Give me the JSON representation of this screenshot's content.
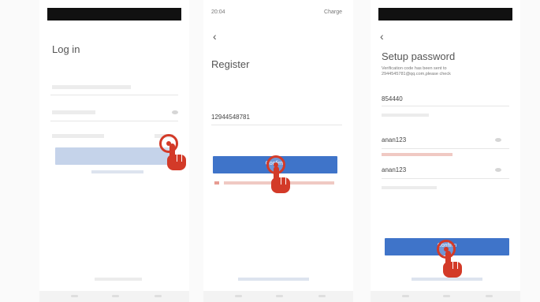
{
  "screen1": {
    "title": "Log in",
    "confirm_button_label": ""
  },
  "screen2": {
    "status_time": "20:04",
    "status_battery": "Charge",
    "back_icon": "chevron-left",
    "title": "Register",
    "phone_value": "12944548781",
    "confirm_button_label": "Confirm"
  },
  "screen3": {
    "back_icon": "chevron-left",
    "title": "Setup password",
    "verification_note": "Verification code has been sent to 2944545781@qq.com,please check",
    "code_value": "854440",
    "password_value": "anan123",
    "confirm_password_value": "anan123",
    "confirm_button_label": "Confirm"
  },
  "colors": {
    "accent_blue": "#3f74c9",
    "disabled_blue": "#c5d3ea",
    "tap_indicator": "#d33a28"
  }
}
